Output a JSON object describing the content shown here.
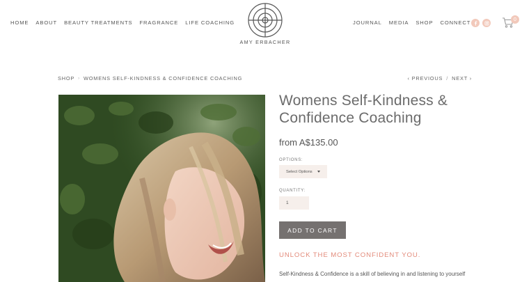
{
  "header": {
    "nav_left": [
      "HOME",
      "ABOUT",
      "BEAUTY TREATMENTS",
      "FRAGRANCE",
      "LIFE COACHING"
    ],
    "nav_right": [
      "JOURNAL",
      "MEDIA",
      "SHOP",
      "CONNECT"
    ],
    "brand_name": "AMY ERBACHER",
    "cart_count": "0",
    "social_icons": [
      "facebook-icon",
      "instagram-icon"
    ],
    "accent_color": "#f2c9bb"
  },
  "breadcrumb": {
    "items": [
      "SHOP",
      "WOMENS SELF-KINDNESS & CONFIDENCE COACHING"
    ],
    "separator": "›"
  },
  "pager": {
    "prev": "‹ PREVIOUS",
    "separator": "/",
    "next": "NEXT ›"
  },
  "product": {
    "title": "Womens Self-Kindness & Confidence Coaching",
    "price": "from A$135.00",
    "options_label": "OPTIONS:",
    "options_selected": "Select Options",
    "quantity_label": "QUANTITY:",
    "quantity_value": "1",
    "add_to_cart": "ADD TO CART",
    "tagline": "UNLOCK THE MOST CONFIDENT YOU.",
    "description": "Self-Kindness & Confidence is a skill of believing in and listening to yourself",
    "tagline_color": "#e38b7b",
    "button_color": "#757170"
  }
}
